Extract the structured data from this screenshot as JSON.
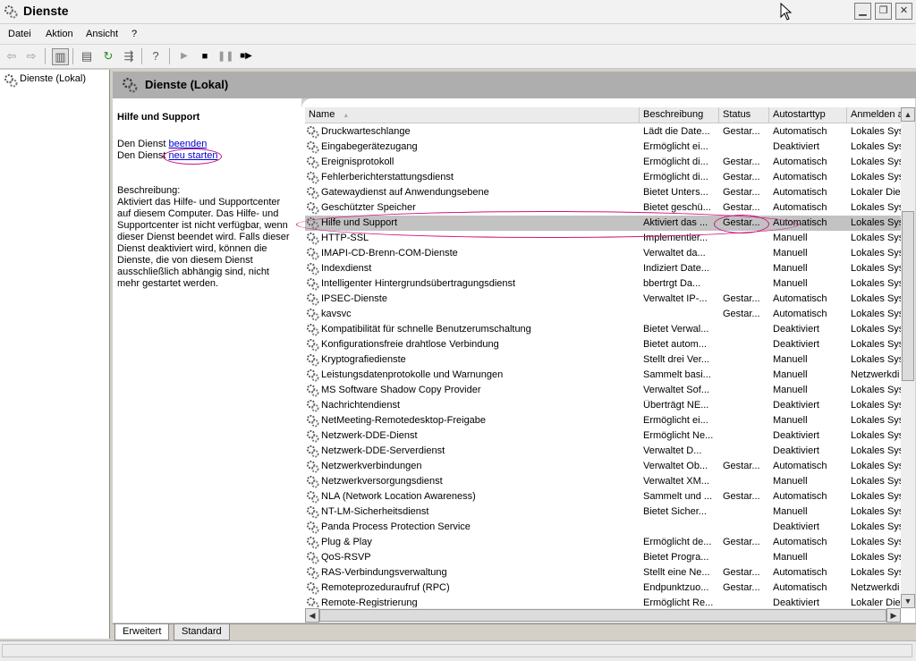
{
  "window": {
    "title": "Dienste"
  },
  "menu": [
    "Datei",
    "Aktion",
    "Ansicht",
    "?"
  ],
  "tree": {
    "root_label": "Dienste (Lokal)"
  },
  "header": {
    "title": "Dienste (Lokal)"
  },
  "detail": {
    "service_title": "Hilfe und Support",
    "stop_prefix": "Den Dienst ",
    "stop_link": "beenden",
    "restart_prefix": "Den Dienst ",
    "restart_link": "neu starten",
    "description_label": "Beschreibung:",
    "description": "Aktiviert das Hilfe- und Supportcenter auf diesem Computer. Das Hilfe- und Supportcenter ist nicht verfügbar, wenn dieser Dienst beendet wird. Falls dieser Dienst deaktiviert wird, können die Dienste, die von diesem Dienst ausschließlich abhängig sind, nicht mehr gestartet werden."
  },
  "columns": [
    "Name",
    "Beschreibung",
    "Status",
    "Autostarttyp",
    "Anmelden a"
  ],
  "sort_indicator": "▲",
  "rows": [
    {
      "name": "Druckwarteschlange",
      "desc": "Lädt die Date...",
      "status": "Gestar...",
      "start": "Automatisch",
      "logon": "Lokales Sys"
    },
    {
      "name": "Eingabegerätezugang",
      "desc": "Ermöglicht ei...",
      "status": "",
      "start": "Deaktiviert",
      "logon": "Lokales Sys"
    },
    {
      "name": "Ereignisprotokoll",
      "desc": "Ermöglicht di...",
      "status": "Gestar...",
      "start": "Automatisch",
      "logon": "Lokales Sys"
    },
    {
      "name": "Fehlerberichterstattungsdienst",
      "desc": "Ermöglicht di...",
      "status": "Gestar...",
      "start": "Automatisch",
      "logon": "Lokales Sys"
    },
    {
      "name": "Gatewaydienst auf Anwendungsebene",
      "desc": "Bietet Unters...",
      "status": "Gestar...",
      "start": "Automatisch",
      "logon": "Lokaler Dien"
    },
    {
      "name": "Geschützter Speicher",
      "desc": "Bietet geschü...",
      "status": "Gestar...",
      "start": "Automatisch",
      "logon": "Lokales Sys"
    },
    {
      "name": "Hilfe und Support",
      "desc": "Aktiviert das ...",
      "status": "Gestar...",
      "start": "Automatisch",
      "logon": "Lokales Sys",
      "selected": true
    },
    {
      "name": "HTTP-SSL",
      "desc": "Implementier...",
      "status": "",
      "start": "Manuell",
      "logon": "Lokales Sys"
    },
    {
      "name": "IMAPI-CD-Brenn-COM-Dienste",
      "desc": "Verwaltet da...",
      "status": "",
      "start": "Manuell",
      "logon": "Lokales Sys"
    },
    {
      "name": "Indexdienst",
      "desc": "Indiziert Date...",
      "status": "",
      "start": "Manuell",
      "logon": "Lokales Sys"
    },
    {
      "name": "Intelligenter Hintergrundsübertragungsdienst",
      "desc": "bbertrgt Da...",
      "status": "",
      "start": "Manuell",
      "logon": "Lokales Sys"
    },
    {
      "name": "IPSEC-Dienste",
      "desc": "Verwaltet IP-...",
      "status": "Gestar...",
      "start": "Automatisch",
      "logon": "Lokales Sys"
    },
    {
      "name": "kavsvc",
      "desc": "",
      "status": "Gestar...",
      "start": "Automatisch",
      "logon": "Lokales Sys"
    },
    {
      "name": "Kompatibilität für schnelle Benutzerumschaltung",
      "desc": "Bietet Verwal...",
      "status": "",
      "start": "Deaktiviert",
      "logon": "Lokales Sys"
    },
    {
      "name": "Konfigurationsfreie drahtlose Verbindung",
      "desc": "Bietet autom...",
      "status": "",
      "start": "Deaktiviert",
      "logon": "Lokales Sys"
    },
    {
      "name": "Kryptografiedienste",
      "desc": "Stellt drei Ver...",
      "status": "",
      "start": "Manuell",
      "logon": "Lokales Sys"
    },
    {
      "name": "Leistungsdatenprotokolle und Warnungen",
      "desc": "Sammelt basi...",
      "status": "",
      "start": "Manuell",
      "logon": "Netzwerkdi"
    },
    {
      "name": "MS Software Shadow Copy Provider",
      "desc": "Verwaltet Sof...",
      "status": "",
      "start": "Manuell",
      "logon": "Lokales Sys"
    },
    {
      "name": "Nachrichtendienst",
      "desc": "Überträgt NE...",
      "status": "",
      "start": "Deaktiviert",
      "logon": "Lokales Sys"
    },
    {
      "name": "NetMeeting-Remotedesktop-Freigabe",
      "desc": "Ermöglicht ei...",
      "status": "",
      "start": "Manuell",
      "logon": "Lokales Sys"
    },
    {
      "name": "Netzwerk-DDE-Dienst",
      "desc": "Ermöglicht Ne...",
      "status": "",
      "start": "Deaktiviert",
      "logon": "Lokales Sys"
    },
    {
      "name": "Netzwerk-DDE-Serverdienst",
      "desc": "Verwaltet D...",
      "status": "",
      "start": "Deaktiviert",
      "logon": "Lokales Sys"
    },
    {
      "name": "Netzwerkverbindungen",
      "desc": "Verwaltet Ob...",
      "status": "Gestar...",
      "start": "Automatisch",
      "logon": "Lokales Sys"
    },
    {
      "name": "Netzwerkversorgungsdienst",
      "desc": "Verwaltet XM...",
      "status": "",
      "start": "Manuell",
      "logon": "Lokales Sys"
    },
    {
      "name": "NLA (Network Location Awareness)",
      "desc": "Sammelt und ...",
      "status": "Gestar...",
      "start": "Automatisch",
      "logon": "Lokales Sys"
    },
    {
      "name": "NT-LM-Sicherheitsdienst",
      "desc": "Bietet Sicher...",
      "status": "",
      "start": "Manuell",
      "logon": "Lokales Sys"
    },
    {
      "name": "Panda Process Protection Service",
      "desc": "",
      "status": "",
      "start": "Deaktiviert",
      "logon": "Lokales Sys"
    },
    {
      "name": "Plug & Play",
      "desc": "Ermöglicht de...",
      "status": "Gestar...",
      "start": "Automatisch",
      "logon": "Lokales Sys"
    },
    {
      "name": "QoS-RSVP",
      "desc": "Bietet Progra...",
      "status": "",
      "start": "Manuell",
      "logon": "Lokales Sys"
    },
    {
      "name": "RAS-Verbindungsverwaltung",
      "desc": "Stellt eine Ne...",
      "status": "Gestar...",
      "start": "Automatisch",
      "logon": "Lokales Sys"
    },
    {
      "name": "Remoteprozeduraufruf (RPC)",
      "desc": "Endpunktzuo...",
      "status": "Gestar...",
      "start": "Automatisch",
      "logon": "Netzwerkdi"
    },
    {
      "name": "Remote-Registrierung",
      "desc": "Ermöglicht Re...",
      "status": "",
      "start": "Deaktiviert",
      "logon": "Lokaler Dien"
    }
  ],
  "tabs": [
    "Erweitert",
    "Standard"
  ],
  "colors": {
    "annotation": "#d0157e",
    "selection": "#c2c2c2",
    "header_bar": "#aeaeae"
  }
}
